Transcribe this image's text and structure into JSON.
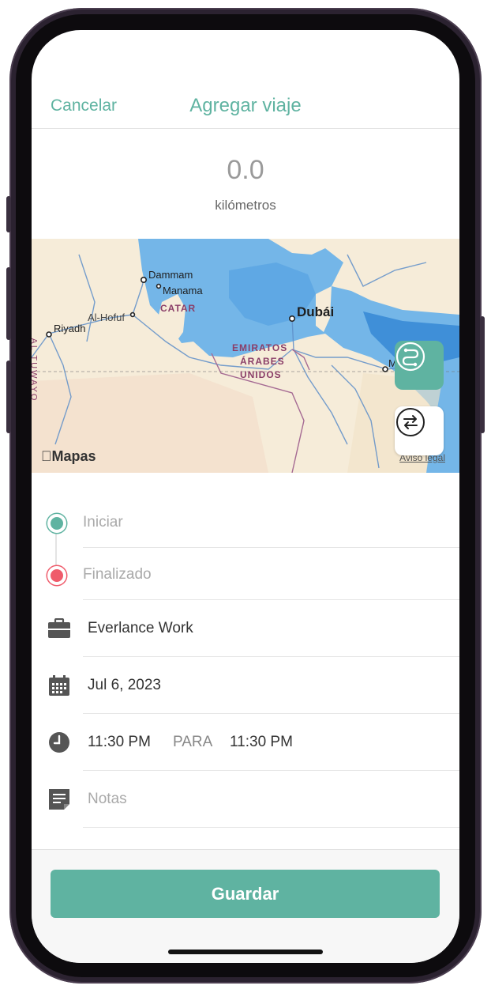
{
  "header": {
    "cancel_label": "Cancelar",
    "title": "Agregar viaje"
  },
  "trip": {
    "distance": "0.0",
    "distance_unit": "kilómetros"
  },
  "map": {
    "brand": "Mapas",
    "legal": "Aviso legal",
    "labels": {
      "dammam": "Dammam",
      "manama": "Manama",
      "catar": "CATAR",
      "al_hofuf": "Al-Hofuf",
      "riyadh": "Riyadh",
      "dubai": "Dubái",
      "emiratos": "EMIRATOS",
      "arabes": "ÁRABES",
      "unidos": "UNIDOS",
      "tuwayq": "AL TUWAYQ",
      "edge_m": "M"
    },
    "colors": {
      "land": "#f6ecd9",
      "water": "#6fb3e6",
      "deep_water": "#3f8fd8"
    }
  },
  "form": {
    "start_placeholder": "Iniciar",
    "end_placeholder": "Finalizado",
    "workspace": "Everlance Work",
    "date": "Jul 6, 2023",
    "start_time": "11:30 PM",
    "time_separator": "PARA",
    "end_time": "11:30 PM",
    "notes_placeholder": "Notas"
  },
  "footer": {
    "save_label": "Guardar"
  },
  "colors": {
    "accent": "#5fb3a1",
    "start_dot": "#5fb3a1",
    "end_dot": "#ef5b6b"
  }
}
